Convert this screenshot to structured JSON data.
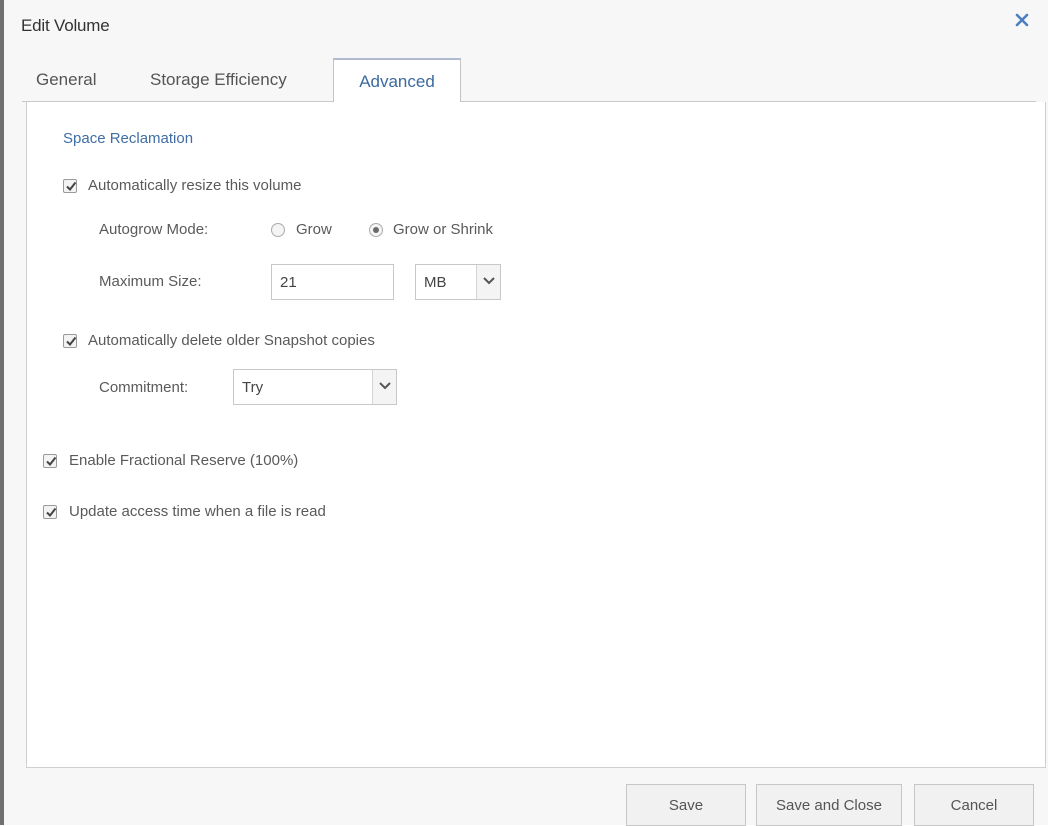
{
  "dialog": {
    "title": "Edit Volume"
  },
  "tabs": [
    {
      "label": "General",
      "selected": false
    },
    {
      "label": "Storage Efficiency",
      "selected": false
    },
    {
      "label": "Advanced",
      "selected": true
    }
  ],
  "space_reclamation": {
    "section_title": "Space Reclamation",
    "auto_resize": {
      "label": "Automatically resize this volume",
      "checked": true
    },
    "autogrow_mode": {
      "label": "Autogrow Mode:",
      "options": [
        {
          "label": "Grow",
          "selected": false
        },
        {
          "label": "Grow or Shrink",
          "selected": true
        }
      ]
    },
    "maximum_size": {
      "label": "Maximum Size:",
      "value": "21",
      "unit": "MB"
    },
    "auto_delete_snapshots": {
      "label": "Automatically delete older Snapshot copies",
      "checked": true
    },
    "commitment": {
      "label": "Commitment:",
      "value": "Try"
    }
  },
  "fractional_reserve": {
    "label": "Enable Fractional Reserve (100%)",
    "checked": true
  },
  "update_access_time": {
    "label": "Update access time when a file is read",
    "checked": true
  },
  "footer": {
    "save_label": "Save",
    "save_close_label": "Save and Close",
    "cancel_label": "Cancel"
  },
  "colors": {
    "accent": "#3f6ea6",
    "close_icon": "#4a7fc1"
  }
}
